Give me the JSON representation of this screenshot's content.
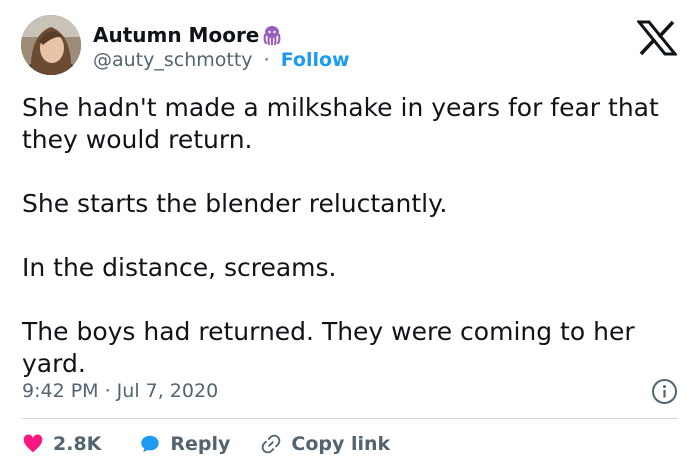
{
  "author": {
    "display_name": "Autumn Moore",
    "handle": "@auty_schmotty",
    "separator": "·",
    "follow_label": "Follow"
  },
  "tweet": {
    "text": "She hadn't made a milkshake in years for fear that\nthey would return.\n\nShe starts the blender reluctantly.\n\nIn the distance, screams.\n\nThe boys had returned. They were coming to her\nyard.",
    "timestamp": "9:42 PM · Jul 7, 2020"
  },
  "actions": {
    "likes": "2.8K",
    "reply_label": "Reply",
    "copy_link_label": "Copy link"
  },
  "colors": {
    "accent": "#1d9bf0",
    "like": "#f91880",
    "octopus": "#9b5fc0"
  },
  "icons": [
    "octopus-emoji-icon",
    "x-logo-icon",
    "info-icon",
    "heart-icon",
    "reply-bubble-icon",
    "link-icon"
  ]
}
